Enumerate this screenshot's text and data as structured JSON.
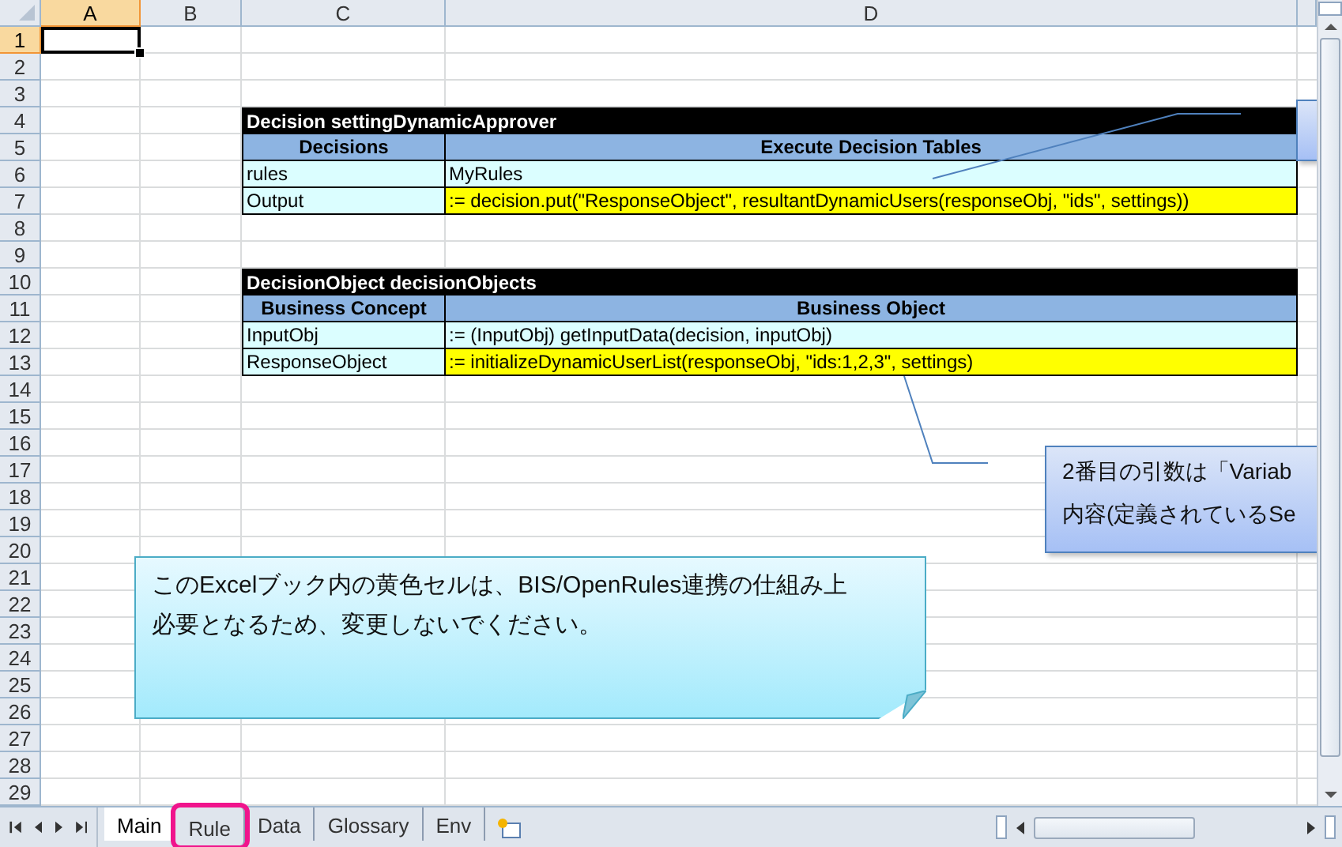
{
  "columns": [
    {
      "label": "A",
      "selected": true
    },
    {
      "label": "B",
      "selected": false
    },
    {
      "label": "C",
      "selected": false
    },
    {
      "label": "D",
      "selected": false
    }
  ],
  "rows": [
    {
      "number": "1",
      "selected": true,
      "kind": "empty"
    },
    {
      "number": "2",
      "selected": false,
      "kind": "empty"
    },
    {
      "number": "3",
      "selected": false,
      "kind": "empty"
    },
    {
      "number": "4",
      "selected": false,
      "kind": "title",
      "title": "Decision settingDynamicApprover"
    },
    {
      "number": "5",
      "selected": false,
      "kind": "header",
      "cells": [
        {
          "text": "Decisions"
        },
        {
          "text": "Execute Decision Tables"
        }
      ]
    },
    {
      "number": "6",
      "selected": false,
      "kind": "data",
      "cells": [
        {
          "text": "rules",
          "highlight": false
        },
        {
          "text": "MyRules",
          "highlight": false
        }
      ]
    },
    {
      "number": "7",
      "selected": false,
      "kind": "data",
      "cells": [
        {
          "text": "Output",
          "highlight": false
        },
        {
          "text": ":= decision.put(\"ResponseObject\", resultantDynamicUsers(responseObj, \"ids\", settings))",
          "highlight": true
        }
      ]
    },
    {
      "number": "8",
      "selected": false,
      "kind": "empty"
    },
    {
      "number": "9",
      "selected": false,
      "kind": "empty"
    },
    {
      "number": "10",
      "selected": false,
      "kind": "title",
      "title": "DecisionObject decisionObjects"
    },
    {
      "number": "11",
      "selected": false,
      "kind": "header",
      "cells": [
        {
          "text": "Business Concept"
        },
        {
          "text": "Business Object"
        }
      ]
    },
    {
      "number": "12",
      "selected": false,
      "kind": "data",
      "cells": [
        {
          "text": "InputObj",
          "highlight": false
        },
        {
          "text": ":= (InputObj) getInputData(decision, inputObj)",
          "highlight": false
        }
      ]
    },
    {
      "number": "13",
      "selected": false,
      "kind": "data",
      "cells": [
        {
          "text": "ResponseObject",
          "highlight": false
        },
        {
          "text": ":= initializeDynamicUserList(responseObj, \"ids:1,2,3\", settings)",
          "highlight": true
        }
      ]
    },
    {
      "number": "14",
      "selected": false,
      "kind": "empty"
    },
    {
      "number": "15",
      "selected": false,
      "kind": "empty"
    },
    {
      "number": "16",
      "selected": false,
      "kind": "empty"
    },
    {
      "number": "17",
      "selected": false,
      "kind": "empty"
    },
    {
      "number": "18",
      "selected": false,
      "kind": "empty"
    },
    {
      "number": "19",
      "selected": false,
      "kind": "empty"
    },
    {
      "number": "20",
      "selected": false,
      "kind": "empty"
    },
    {
      "number": "21",
      "selected": false,
      "kind": "empty"
    },
    {
      "number": "22",
      "selected": false,
      "kind": "empty"
    },
    {
      "number": "23",
      "selected": false,
      "kind": "empty"
    },
    {
      "number": "24",
      "selected": false,
      "kind": "empty"
    },
    {
      "number": "25",
      "selected": false,
      "kind": "empty"
    },
    {
      "number": "26",
      "selected": false,
      "kind": "empty"
    },
    {
      "number": "27",
      "selected": false,
      "kind": "empty"
    },
    {
      "number": "28",
      "selected": false,
      "kind": "empty"
    },
    {
      "number": "29",
      "selected": false,
      "kind": "empty"
    }
  ],
  "notes": [
    {
      "kind": "edge"
    },
    {
      "kind": "side",
      "lines": [
        "2番目の引数は「Variab",
        "内容(定義されているSe"
      ]
    },
    {
      "kind": "folded",
      "lines": [
        "このExcelブック内の黄色セルは、BIS/OpenRules連携の仕組み上",
        "必要となるため、変更しないでください。"
      ]
    }
  ],
  "sheet_tabs": [
    {
      "label": "Main",
      "selected": true,
      "marked": false
    },
    {
      "label": "Rule",
      "selected": false,
      "marked": true
    },
    {
      "label": "Data",
      "selected": false,
      "marked": false
    },
    {
      "label": "Glossary",
      "selected": false,
      "marked": false
    },
    {
      "label": "Env",
      "selected": false,
      "marked": false
    }
  ]
}
